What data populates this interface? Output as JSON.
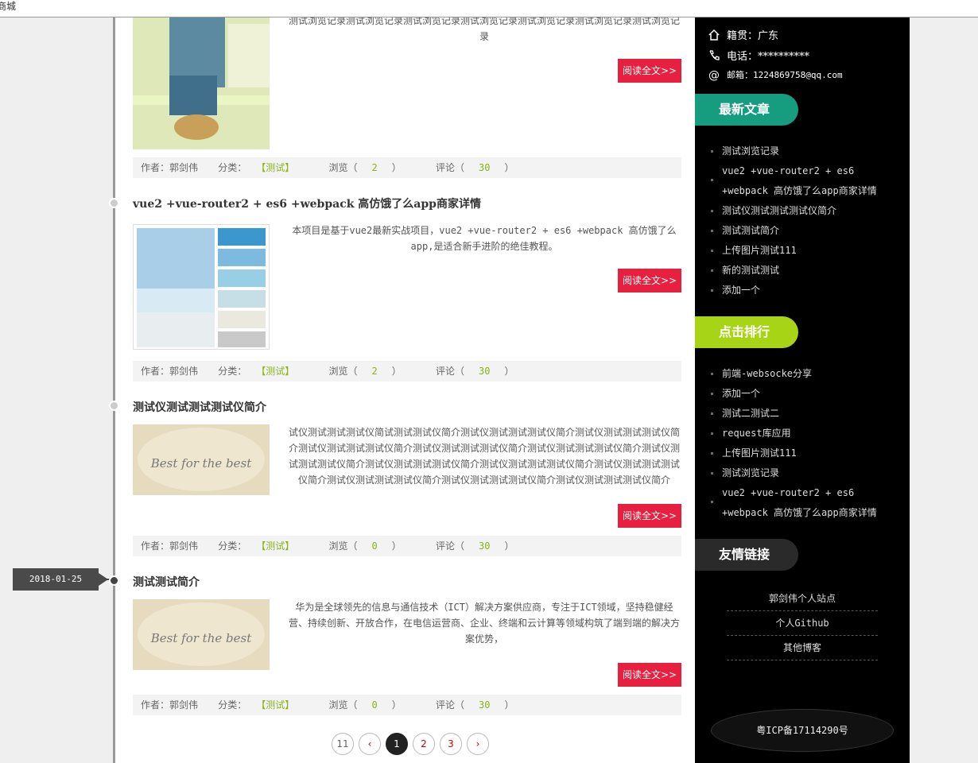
{
  "topbar": {
    "text": "商城"
  },
  "posts": [
    {
      "title": "",
      "excerpt": "测试浏览记录测试浏览记录测试浏览记录测试浏览记录测试浏览记录测试浏览记录测试浏览记录",
      "read_label": "阅读全文>>",
      "author": "作者：郭剑伟",
      "category_prefix": "分类：",
      "category": "【测试】",
      "views_prefix": "浏览（",
      "views": "2",
      "views_suffix": "）",
      "comments_prefix": "评论（",
      "comments": "30",
      "comments_suffix": "）"
    },
    {
      "title": "vue2 +vue-router2 + es6 +webpack 高仿饿了么app商家详情",
      "excerpt": "本项目是基于vue2最新实战项目，vue2 +vue-router2 + es6 +webpack 高仿饿了么app,是适合新手进阶的绝佳教程。",
      "read_label": "阅读全文>>",
      "author": "作者：郭剑伟",
      "category_prefix": "分类：",
      "category": "【测试】",
      "views_prefix": "浏览（",
      "views": "2",
      "views_suffix": "）",
      "comments_prefix": "评论（",
      "comments": "30",
      "comments_suffix": "）"
    },
    {
      "title": "测试仪测试测试测试仪简介",
      "excerpt": "试仪测试测试测试仪简试测试测试仪简介测试仪测试测试测试仪简介测试仪测试测试测试仪简介测试仪测试测试测试仪简介测试仪测试测试测试仪简介测试仪测试测试测试仪简介测试仪测试测试测试仪简介测试仪测试测试测试仪简介测试仪测试测试测试仪简介测试仪测试测试测试仪简介测试仪测试测试测试仪简介测试仪测试测试测试仪简介测试仪测试测试测试仪简介",
      "image_text": "Best for the best",
      "read_label": "阅读全文>>",
      "author": "作者：郭剑伟",
      "category_prefix": "分类：",
      "category": "【测试】",
      "views_prefix": "浏览（",
      "views": "0",
      "views_suffix": "）",
      "comments_prefix": "评论（",
      "comments": "30",
      "comments_suffix": "）"
    },
    {
      "title": "测试测试简介",
      "excerpt": "华为是全球领先的信息与通信技术（ICT）解决方案供应商，专注于ICT领域，坚持稳健经营、持续创新、开放合作，在电信运营商、企业、终端和云计算等领域构筑了端到端的解决方案优势，",
      "image_text": "Best for the best",
      "read_label": "阅读全文>>",
      "author": "作者：郭剑伟",
      "category_prefix": "分类：",
      "category": "【测试】",
      "views_prefix": "浏览（",
      "views": "0",
      "views_suffix": "）",
      "comments_prefix": "评论（",
      "comments": "30",
      "comments_suffix": "）"
    }
  ],
  "date_tag": "2018-01-25",
  "pager": {
    "first": "11",
    "prev": "‹",
    "pages": [
      "1",
      "2",
      "3"
    ],
    "next": "›"
  },
  "sidebar": {
    "hometown": "籍贯：广东",
    "phone": "电话：**********",
    "email": "邮箱：1224869758@qq.com",
    "latest_title": "最新文章",
    "latest": [
      "测试浏览记录",
      "vue2 +vue-router2 + es6 +webpack 高仿饿了么app商家详情",
      "测试仪测试测试测试仪简介",
      "测试测试简介",
      "上传图片测试111",
      "新的测试测试",
      "添加一个"
    ],
    "rank_title": "点击排行",
    "rank": [
      "前端-websocke分享",
      "添加一个",
      "测试二测试二",
      "request库应用",
      "上传图片测试111",
      "测试浏览记录",
      "vue2 +vue-router2 + es6 +webpack 高仿饿了么app商家详情"
    ],
    "links_title": "友情链接",
    "links": [
      "郭剑伟个人站点",
      "个人Github",
      "其他博客"
    ],
    "icp": "粤ICP备17114290号"
  },
  "colors": {
    "accent_red": "#e8203f",
    "green_head": "#169c7e",
    "lime_head": "#a8d416",
    "link_green": "#8ab31c"
  }
}
